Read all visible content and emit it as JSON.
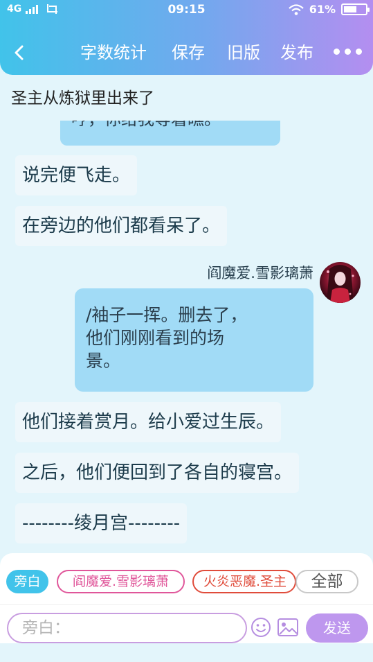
{
  "status_bar": {
    "network": "4G",
    "time": "09:15",
    "battery_text": "61%",
    "battery_level": 0.61
  },
  "header": {
    "nav_items": [
      "字数统计",
      "保存",
      "旧版",
      "发布"
    ]
  },
  "story_title": "圣主从炼狱里出来了",
  "messages": {
    "partial_bubble": "哼，你给我等着瞧。",
    "narrations": [
      "说完便飞走。",
      "在旁边的他们都看呆了。",
      "他们接着赏月。给小爱过生辰。",
      "之后，他们便回到了各自的寝宫。",
      "--------绫月宫--------"
    ],
    "user_message": {
      "username": "阎魔爱.雪影璃萧",
      "lines": [
        "/袖子一挥。删去了，",
        "他们刚刚看到的场",
        "景。"
      ]
    }
  },
  "composer": {
    "chips": [
      "旁白",
      "阎魔爱.雪影璃萧",
      "火炎恶魔.圣主",
      "全部"
    ],
    "input_placeholder": "旁白：",
    "send_label": "发送"
  },
  "colors": {
    "header_gradient_start": "#41c3ea",
    "header_gradient_end": "#b48ef0",
    "bubble": "#a1dbf6",
    "background": "#e3f5fb",
    "send_button": "#be97ee",
    "chip_active": "#41c3ea",
    "chip_role_pink": "#e0569a",
    "chip_role_red": "#e04c3b"
  },
  "icons": [
    "signal-icon",
    "screenshot-icon",
    "wifi-icon",
    "battery-icon",
    "back-arrow-icon",
    "more-icon",
    "emoji-icon",
    "image-icon"
  ]
}
